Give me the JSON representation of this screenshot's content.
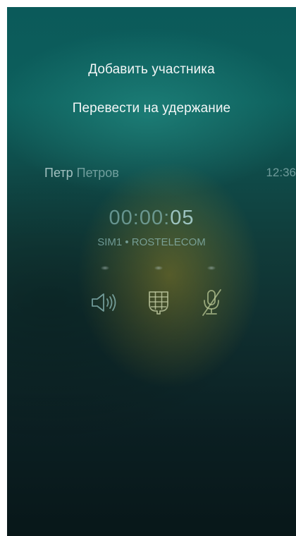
{
  "menu": {
    "add_participant": "Добавить участника",
    "hold": "Перевести на удержание"
  },
  "call": {
    "caller_first": "Петр",
    "caller_last": "Петров",
    "clock": "12:36",
    "timer_prefix": "00:00:",
    "timer_seconds": "05",
    "sim_info": "SIM1 • ROSTELECOM"
  },
  "controls": {
    "speaker_icon": "speaker-icon",
    "keypad_icon": "keypad-icon",
    "mute_icon": "microphone-off-icon"
  },
  "colors": {
    "background_top": "#0b5a5a",
    "background_bottom": "#081719",
    "menu_text": "#f2f6f6"
  }
}
